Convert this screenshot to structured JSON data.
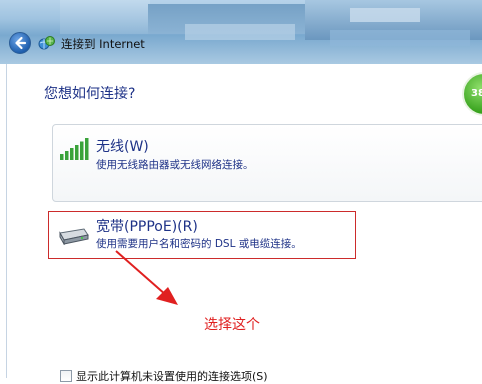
{
  "window": {
    "title": "连接到 Internet"
  },
  "main": {
    "question": "您想如何连接?",
    "badge": "38"
  },
  "options": [
    {
      "title": "无线(W)",
      "description": "使用无线路由器或无线网络连接。",
      "icon": "wifi-signal-icon"
    },
    {
      "title": "宽带(PPPoE)(R)",
      "description": "使用需要用户名和密码的 DSL 或电缆连接。",
      "icon": "modem-icon"
    }
  ],
  "annotation": {
    "text": "选择这个",
    "color": "#e02020"
  },
  "footer": {
    "checkbox_label": "显示此计算机未设置使用的连接选项(S)",
    "checked": false
  },
  "colors": {
    "link_blue": "#1e3287",
    "highlight_red": "#cc2b2b"
  }
}
